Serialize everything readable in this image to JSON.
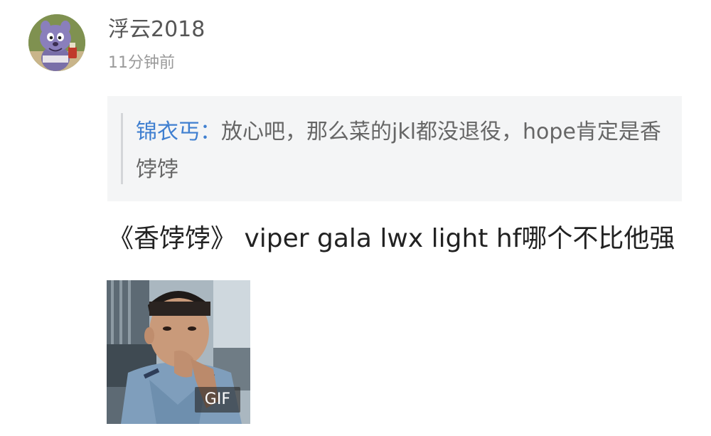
{
  "user": {
    "name": "浮云2018",
    "time": "11分钟前"
  },
  "quote": {
    "author": "锦衣丐：",
    "text": "放心吧，那么菜的jkl都没退役，hope肯定是香饽饽"
  },
  "reply": {
    "text": "《香饽饽》 viper gala lwx light hf哪个不比他强"
  },
  "media": {
    "badge": "GIF"
  },
  "colors": {
    "quote_author": "#3f7fd0",
    "quote_background": "#f4f5f6"
  }
}
